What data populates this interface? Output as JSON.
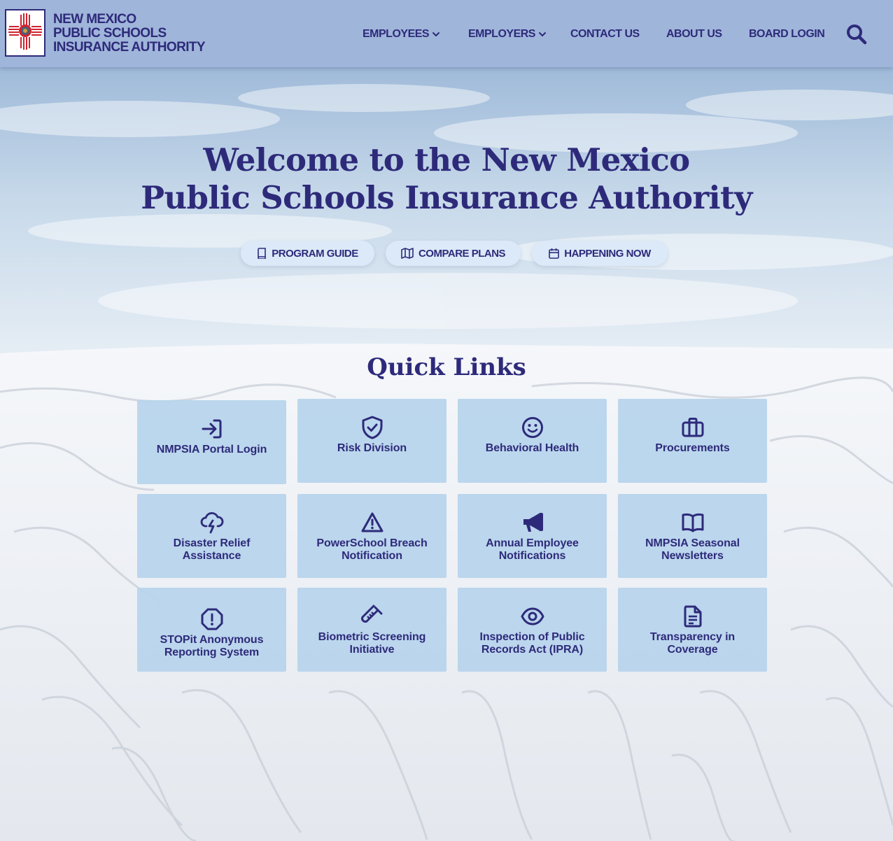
{
  "header": {
    "brand_lines": [
      "NEW MEXICO",
      "PUBLIC SCHOOLS",
      "INSURANCE AUTHORITY"
    ],
    "nav": [
      {
        "label": "EMPLOYEES",
        "dropdown": true
      },
      {
        "label": "EMPLOYERS",
        "dropdown": true
      },
      {
        "label": "CONTACT US",
        "dropdown": false
      },
      {
        "label": "ABOUT US",
        "dropdown": false
      },
      {
        "label": "BOARD LOGIN",
        "dropdown": false
      }
    ],
    "search_icon": "search-icon"
  },
  "hero": {
    "title_line1": "Welcome to the New Mexico",
    "title_line2": "Public Schools Insurance Authority",
    "buttons": [
      {
        "label": "PROGRAM GUIDE",
        "icon": "book-icon"
      },
      {
        "label": "COMPARE PLANS",
        "icon": "map-icon"
      },
      {
        "label": "HAPPENING NOW",
        "icon": "calendar-icon"
      }
    ]
  },
  "quick_links": {
    "title": "Quick Links",
    "items": [
      {
        "label": "NMPSIA Portal Login",
        "icon": "login-icon"
      },
      {
        "label": "Risk Division",
        "icon": "shield-check-icon"
      },
      {
        "label": "Behavioral Health",
        "icon": "smile-icon"
      },
      {
        "label": "Procurements",
        "icon": "briefcase-icon"
      },
      {
        "label": "Disaster Relief Assistance",
        "icon": "storm-icon"
      },
      {
        "label": "PowerSchool Breach Notification",
        "icon": "warning-icon"
      },
      {
        "label": "Annual Employee Notifications",
        "icon": "megaphone-icon"
      },
      {
        "label": "NMPSIA Seasonal Newsletters",
        "icon": "open-book-icon"
      },
      {
        "label": "STOPit Anonymous Reporting System",
        "icon": "alert-octagon-icon"
      },
      {
        "label": "Biometric Screening Initiative",
        "icon": "test-tube-icon"
      },
      {
        "label": "Inspection of Public Records Act (IPRA)",
        "icon": "eye-icon"
      },
      {
        "label": "Transparency in Coverage",
        "icon": "document-icon"
      }
    ]
  },
  "colors": {
    "primary": "#2e2a7a",
    "header_bg": "#9fb5da",
    "card_bg": "#b7d4ec",
    "pill_bg": "#dbe9f8",
    "logo_red": "#d0242e"
  }
}
